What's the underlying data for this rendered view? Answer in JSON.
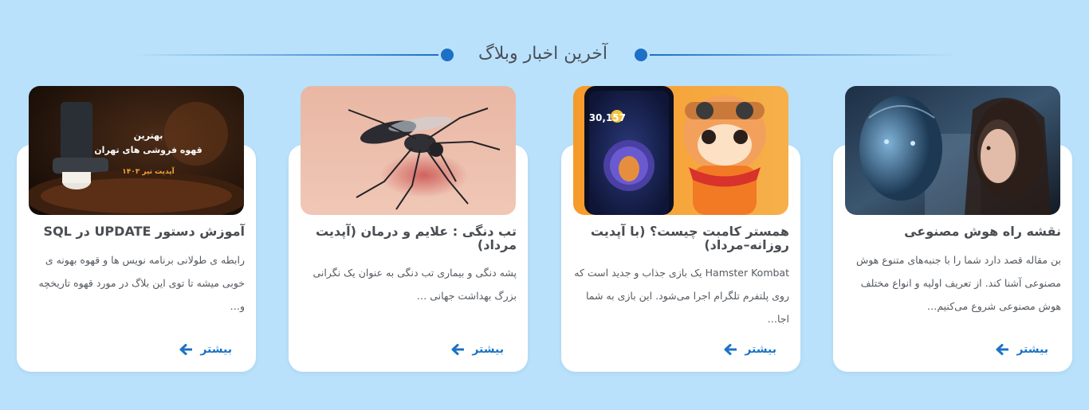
{
  "section": {
    "title": "آخرین اخبار وبلاگ"
  },
  "posts": [
    {
      "title": "نقشه راه هوش مصنوعی",
      "excerpt": "بن مقاله قصد دارد شما را با جنبه‌های متنوع هوش مصنوعی آشنا کند. از تعریف اولیه و انواع مختلف هوش مصنوعی شروع می‌کنیم…",
      "more": "بیشتر",
      "image": "ai-faces-image"
    },
    {
      "title": "همستر کامبت چیست؟ (با آپدیت روزانه–مرداد)",
      "excerpt": "Hamster Kombat یک بازی جذاب و جدید است که روی پلتفرم تلگرام اجرا می‌شود. این بازی به شما اجا…",
      "more": "بیشتر",
      "image": "hamster-kombat-image",
      "image_text": {
        "score": "30,157"
      }
    },
    {
      "title": "تب دنگی : علایم و درمان (آپدیت مرداد)",
      "excerpt": "پشه دنگی و بیماری تب دنگی به عنوان یک نگرانی بزرگ بهداشت جهانی …",
      "more": "بیشتر",
      "image": "mosquito-image"
    },
    {
      "title": "آموزش دستور UPDATE در SQL",
      "excerpt": "رابطه ی طولانی برنامه نویس ها و قهوه بهونه ی خوبی میشه تا توی این بلاگ در مورد قهوه تاریخچه و…",
      "more": "بیشتر",
      "image": "coffee-image",
      "image_text": {
        "line1": "بهترین",
        "line2": "قهوه فروشی های تهران",
        "line3": "آپدیت تیر ۱۴۰۳"
      }
    }
  ]
}
